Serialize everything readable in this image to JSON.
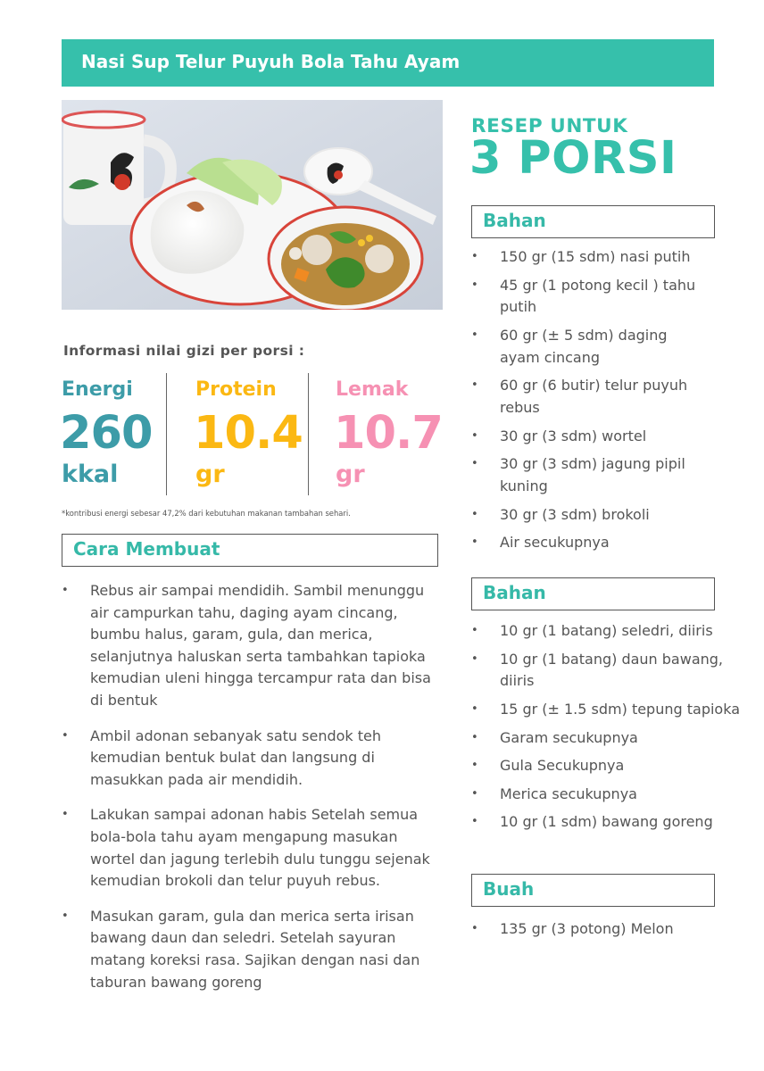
{
  "title": "Nasi Sup Telur Puyuh Bola Tahu Ayam",
  "nutrition": {
    "heading": "Informasi nilai gizi per porsi :",
    "items": [
      {
        "name": "Energi",
        "value": "260",
        "unit": "kkal",
        "color": "#3d9ca8"
      },
      {
        "name": "Protein",
        "value": "10.4",
        "unit": "gr",
        "color": "#fbb813"
      },
      {
        "name": "Lemak",
        "value": "10.7",
        "unit": "gr",
        "color": "#f691b3"
      }
    ],
    "footnote": "*kontribusi energi sebesar 47,2% dari kebutuhan makanan tambahan sehari."
  },
  "steps": {
    "heading": "Cara Membuat",
    "items": [
      "Rebus air sampai mendidih. Sambil menunggu air campurkan tahu, daging ayam cincang, bumbu halus, garam, gula, dan merica, selanjutnya haluskan serta tambahkan tapioka kemudian uleni hingga tercampur rata dan bisa di bentuk",
      "Ambil adonan sebanyak satu sendok teh kemudian bentuk bulat dan langsung di masukkan pada air mendidih.",
      "Lakukan sampai adonan habis Setelah semua bola-bola tahu ayam mengapung masukan wortel dan jagung terlebih dulu tunggu sejenak kemudian brokoli dan telur puyuh rebus.",
      "Masukan garam, gula dan merica serta irisan bawang daun dan seledri. Setelah sayuran matang koreksi rasa. Sajikan dengan nasi dan taburan bawang goreng"
    ]
  },
  "recipe": {
    "label": "RESEP UNTUK",
    "portions": "3 PORSI"
  },
  "bullet": "•",
  "ingredients": [
    {
      "heading": "Bahan",
      "items": [
        "150 gr (15 sdm) nasi putih",
        "45 gr (1 potong kecil ) tahu\nputih",
        "60 gr (± 5 sdm) daging\nayam cincang",
        "60 gr (6 butir) telur puyuh\nrebus",
        "30 gr (3 sdm) wortel",
        "30 gr (3 sdm) jagung pipil\nkuning",
        "30 gr (3 sdm) brokoli",
        "Air secukupnya"
      ]
    },
    {
      "heading": "Bahan",
      "items": [
        "10 gr (1 batang) seledri, diiris",
        "10 gr (1 batang) daun bawang,\ndiiris",
        "15 gr (± 1.5 sdm) tepung tapioka",
        "Garam secukupnya",
        "Gula Secukupnya",
        "Merica secukupnya",
        "10 gr (1 sdm) bawang goreng"
      ]
    },
    {
      "heading": "Buah",
      "items": [
        "135 gr (3 potong) Melon"
      ]
    }
  ]
}
